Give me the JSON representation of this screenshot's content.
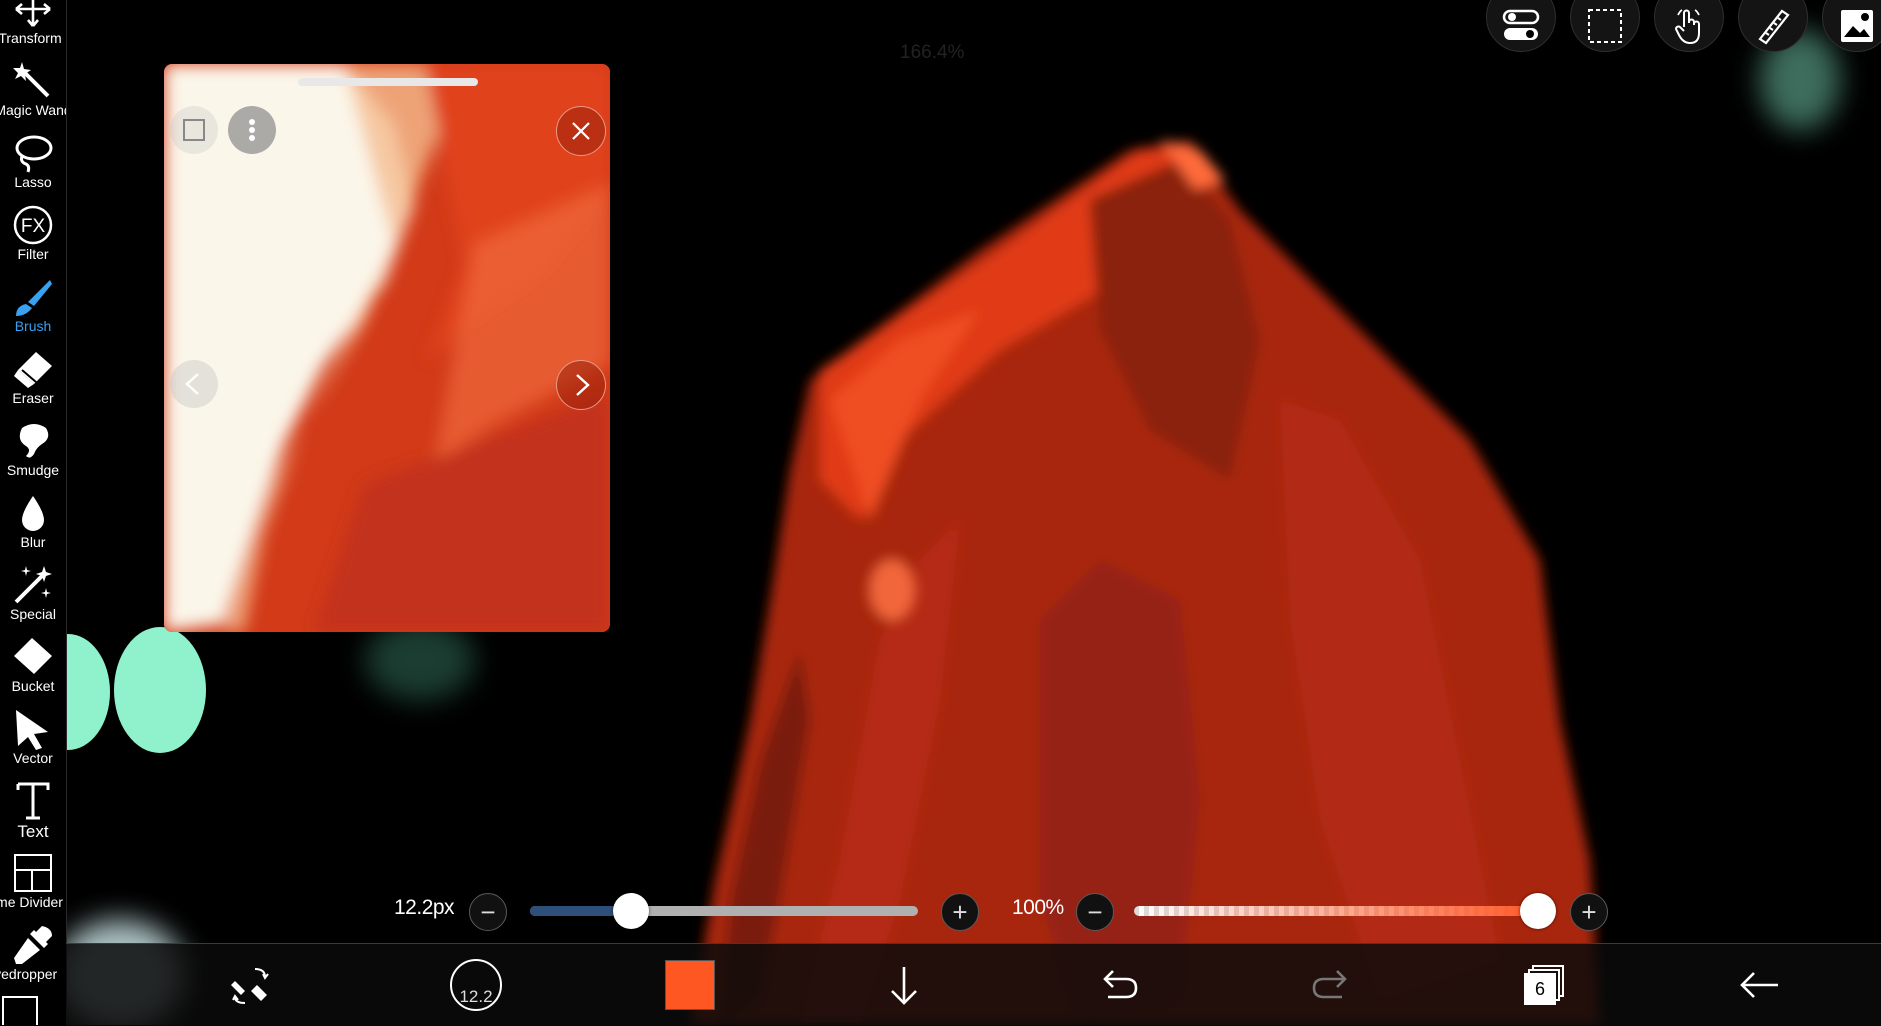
{
  "canvas": {
    "zoom_label": "166.4%"
  },
  "toolbar": {
    "tools": [
      {
        "label": "Transform",
        "icon": "transform-icon"
      },
      {
        "label": "Magic Wand",
        "icon": "magic-wand-icon"
      },
      {
        "label": "Lasso",
        "icon": "lasso-icon"
      },
      {
        "label": "Filter",
        "icon": "filter-fx-icon"
      },
      {
        "label": "Brush",
        "icon": "brush-icon",
        "active": true
      },
      {
        "label": "Eraser",
        "icon": "eraser-icon"
      },
      {
        "label": "Smudge",
        "icon": "smudge-icon"
      },
      {
        "label": "Blur",
        "icon": "blur-icon"
      },
      {
        "label": "Special",
        "icon": "special-icon"
      },
      {
        "label": "Bucket",
        "icon": "bucket-icon"
      },
      {
        "label": "Vector",
        "icon": "vector-icon"
      },
      {
        "label": "Text",
        "icon": "text-icon"
      },
      {
        "label": "Frame Divider",
        "icon": "frame-divider-icon"
      },
      {
        "label": "Eyedropper",
        "icon": "eyedropper-icon"
      }
    ]
  },
  "top_actions": [
    "toggle-icon",
    "selection-icon",
    "hand-gesture-icon",
    "ruler-icon",
    "image-icon"
  ],
  "brush_size": {
    "value_label": "12.2px",
    "level": 0.26
  },
  "opacity": {
    "value_label": "100%",
    "level": 1.0
  },
  "bottom_bar": {
    "brush_indicator": "12.2",
    "color": "#ff5722",
    "layer_count": "6"
  },
  "colors": {
    "accent": "#3aa0f0",
    "brush_slider": "#2e4f7a",
    "opacity_slider": "#ff5a2a",
    "paint_red": "#c92f15"
  }
}
